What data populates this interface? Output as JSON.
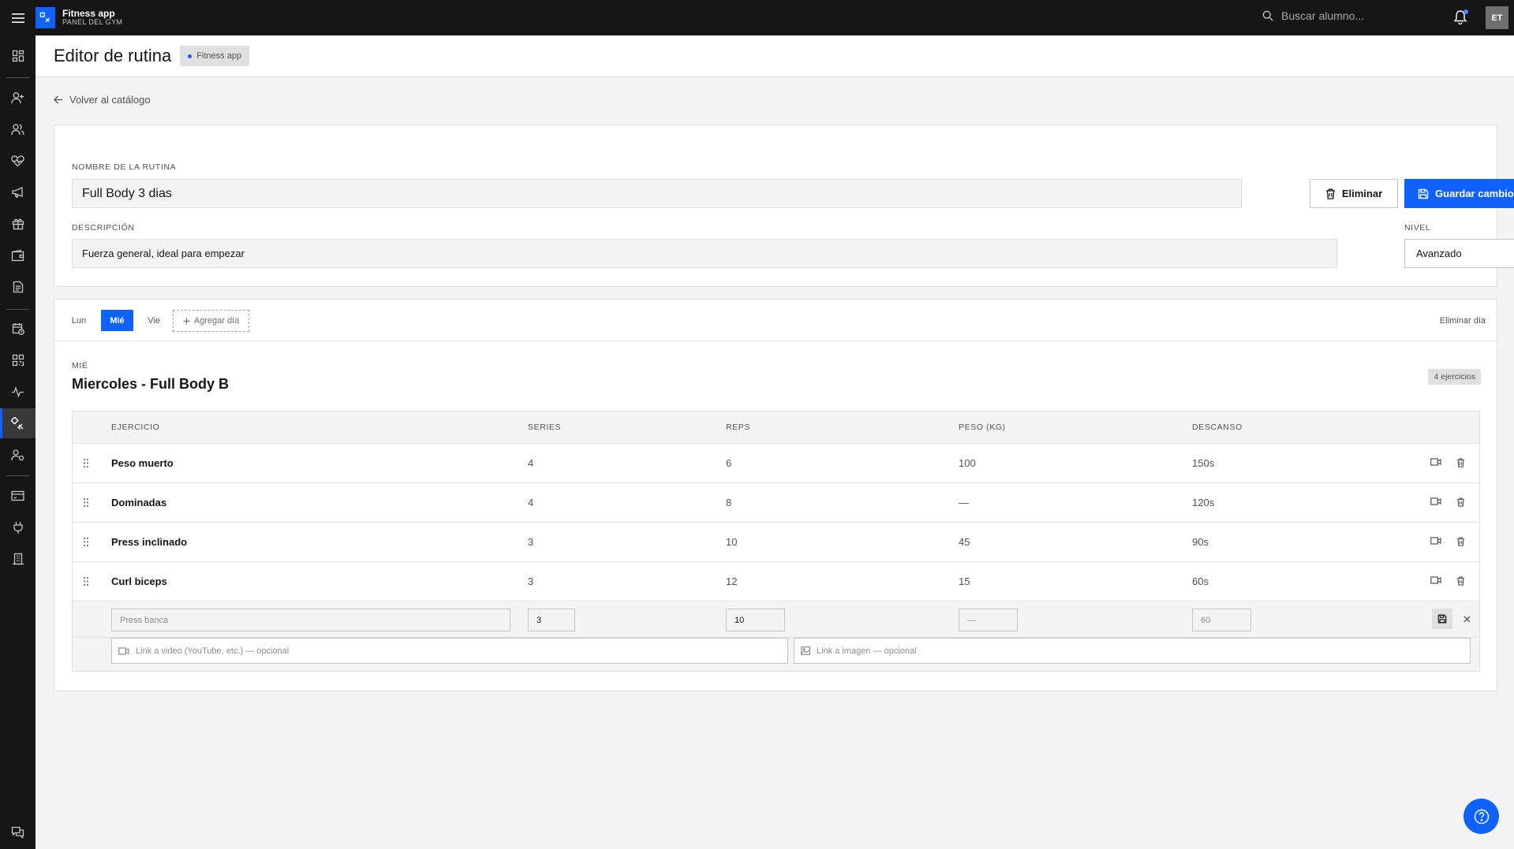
{
  "app": {
    "brand_name": "Fitness app",
    "brand_sub": "PANEL DEL GYM",
    "search_placeholder": "Buscar alumno...",
    "avatar_initials": "ET",
    "accent_color": "#0f62fe"
  },
  "sidebar": {
    "items": [
      {
        "icon": "dashboard-icon"
      },
      {
        "icon": "add-user-icon"
      },
      {
        "icon": "users-icon"
      },
      {
        "icon": "health-icon"
      },
      {
        "icon": "megaphone-icon"
      },
      {
        "icon": "gift-icon"
      },
      {
        "icon": "wallet-icon"
      },
      {
        "icon": "document-icon"
      },
      {
        "icon": "calendar-clock-icon"
      },
      {
        "icon": "qr-code-icon"
      },
      {
        "icon": "activity-icon"
      },
      {
        "icon": "routine-icon",
        "active": true
      },
      {
        "icon": "user-settings-icon"
      },
      {
        "icon": "credit-card-icon"
      },
      {
        "icon": "plug-icon"
      },
      {
        "icon": "building-icon"
      },
      {
        "icon": "chat-icon"
      }
    ]
  },
  "header": {
    "title": "Editor de rutina",
    "tag": "Fitness app"
  },
  "back_link": "Volver al catálogo",
  "routine": {
    "name_label": "NOMBRE DE LA RUTINA",
    "name_value": "Full Body 3 dias",
    "description_label": "DESCRIPCIÓN",
    "description_value": "Fuerza general, ideal para empezar",
    "level_label": "NIVEL",
    "level_value": "Avanzado",
    "delete_label": "Eliminar",
    "save_label": "Guardar cambios"
  },
  "days": {
    "tabs": [
      {
        "label": "Lun",
        "active": false
      },
      {
        "label": "Mié",
        "active": true
      },
      {
        "label": "Vie",
        "active": false
      }
    ],
    "add_day_label": "Agregar día",
    "remove_day_label": "Eliminar día"
  },
  "day": {
    "eyebrow": "MIÉ",
    "title": "Miercoles - Full Body B",
    "exercise_count": "4 ejercicios"
  },
  "table": {
    "headers": [
      "EJERCICIO",
      "SERIES",
      "REPS",
      "PESO (KG)",
      "DESCANSO"
    ],
    "rows": [
      {
        "name": "Peso muerto",
        "series": "4",
        "reps": "6",
        "weight": "100",
        "rest": "150s"
      },
      {
        "name": "Dominadas",
        "series": "4",
        "reps": "8",
        "weight": "—",
        "rest": "120s"
      },
      {
        "name": "Press inclinado",
        "series": "3",
        "reps": "10",
        "weight": "45",
        "rest": "90s"
      },
      {
        "name": "Curl biceps",
        "series": "3",
        "reps": "12",
        "weight": "15",
        "rest": "60s"
      }
    ],
    "new_row": {
      "name_placeholder": "Press banca",
      "series_value": "3",
      "reps_value": "10",
      "weight_placeholder": "—",
      "rest_placeholder": "60",
      "video_placeholder": "Link a video (YouTube, etc.) — opcional",
      "image_placeholder": "Link a imagen — opcional"
    }
  }
}
